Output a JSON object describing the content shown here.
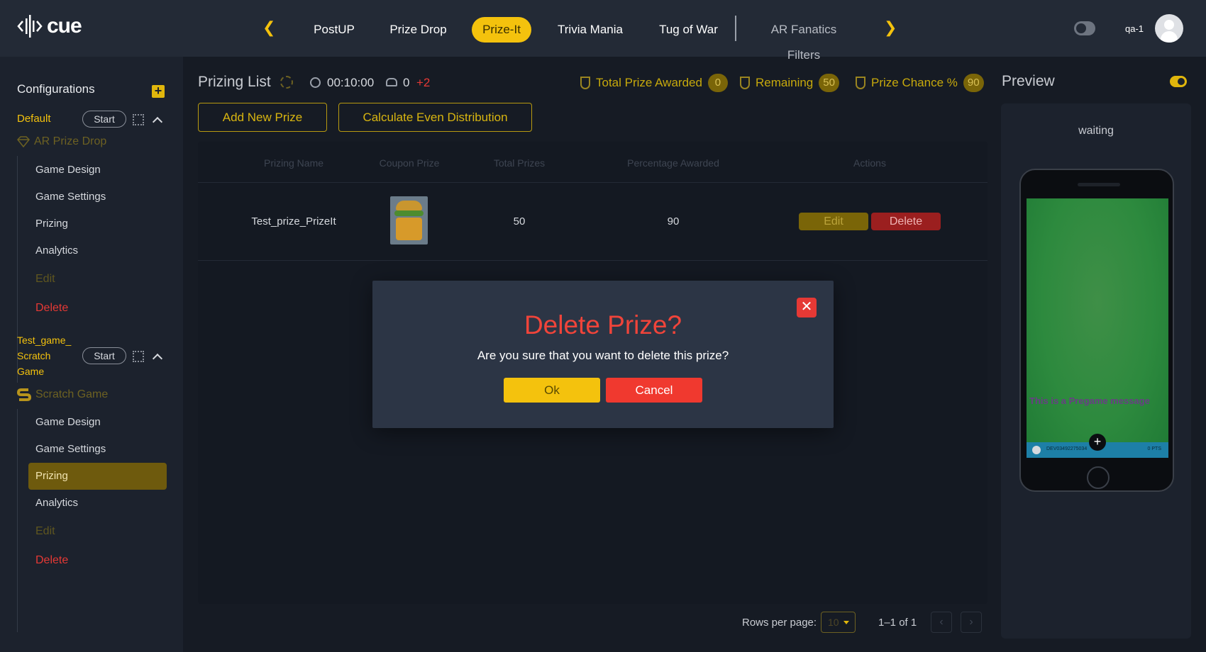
{
  "app": {
    "brand": "cue",
    "user": "qa-1"
  },
  "nav": {
    "tabs": [
      {
        "label": "PostUP"
      },
      {
        "label": "Prize Drop"
      },
      {
        "label": "Prize-It"
      },
      {
        "label": "Trivia Mania"
      },
      {
        "label": "Tug of War"
      },
      {
        "label": "AR Fanatics Filters"
      }
    ],
    "active_tab": "Prize-It"
  },
  "sidebar": {
    "title": "Configurations",
    "configs": [
      {
        "name": "Default",
        "start_label": "Start",
        "game_type": "AR Prize Drop",
        "items": [
          "Game Design",
          "Game Settings",
          "Prizing",
          "Analytics",
          "Edit",
          "Delete"
        ]
      },
      {
        "name_lines": [
          "Test_game_",
          "Scratch",
          "Game"
        ],
        "start_label": "Start",
        "game_type": "Scratch Game",
        "items": [
          "Game Design",
          "Game Settings",
          "Prizing",
          "Analytics",
          "Edit",
          "Delete"
        ]
      }
    ]
  },
  "main": {
    "title": "Prizing List",
    "timer": "00:10:00",
    "players": "0",
    "players_delta": "+2",
    "stats": [
      {
        "label": "Total Prize Awarded",
        "value": "0"
      },
      {
        "label": "Remaining",
        "value": "50"
      },
      {
        "label": "Prize Chance %",
        "value": "90"
      }
    ],
    "add_prize_label": "Add New Prize",
    "calc_label": "Calculate Even Distribution",
    "table": {
      "headers": [
        "Prizing Name",
        "Coupon Prize",
        "Total Prizes",
        "Percentage Awarded",
        "Actions"
      ],
      "rows": [
        {
          "name": "Test_prize_PrizeIt",
          "coupon_image": "burger-fries-image",
          "total": "50",
          "percentage": "90",
          "edit_label": "Edit",
          "delete_label": "Delete"
        }
      ]
    },
    "pagination": {
      "rows_label": "Rows per page:",
      "rows_value": "10",
      "range": "1–1 of 1"
    }
  },
  "preview": {
    "title": "Preview",
    "status": "waiting",
    "pregame_message": "This is a Pregame message",
    "footer_id": "DEV03492275034",
    "footer_pts": "0 PTS"
  },
  "modal": {
    "title": "Delete Prize?",
    "message": "Are you sure that you want to delete this prize?",
    "ok_label": "Ok",
    "cancel_label": "Cancel"
  },
  "colors": {
    "accent": "#f4c20d",
    "danger": "#e53935",
    "background": "#161b24",
    "panel": "#1c222d"
  }
}
